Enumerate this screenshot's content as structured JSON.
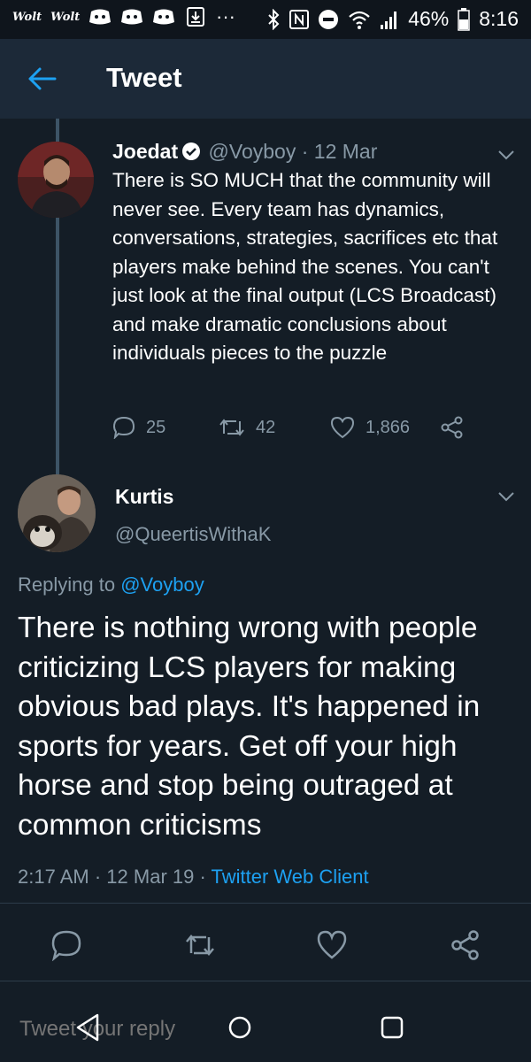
{
  "status_bar": {
    "app1": "Wolt",
    "app2": "Wolt",
    "dots": "···",
    "battery": "46%",
    "time": "8:16"
  },
  "header": {
    "title": "Tweet"
  },
  "parent_tweet": {
    "name": "Joedat",
    "handle": "@Voyboy",
    "separator": "·",
    "date": "12 Mar",
    "text": "There is SO MUCH that the community will never see. Every team has dynamics, conversations, strategies, sacrifices etc that players make behind the scenes. You can't just look at the final output (LCS Broadcast) and make dramatic conclusions about individuals pieces to the puzzle",
    "replies": "25",
    "retweets": "42",
    "likes": "1,866"
  },
  "main_tweet": {
    "name": "Kurtis",
    "handle": "@QueertisWithaK",
    "replying_label": "Replying to",
    "replying_to": "@Voyboy",
    "text": "There is nothing wrong with people criticizing LCS players for making obvious bad plays. It's happened in sports for years. Get off your high horse and stop being outraged at common criticisms",
    "time": "2:17 AM",
    "sep1": "·",
    "date": "12 Mar 19",
    "sep2": "·",
    "client": "Twitter Web Client"
  },
  "reply": {
    "placeholder": "Tweet your reply"
  },
  "colors": {
    "background": "#141d26",
    "header": "#1c2938",
    "accent": "#1da1f2",
    "muted": "#8899a6"
  }
}
